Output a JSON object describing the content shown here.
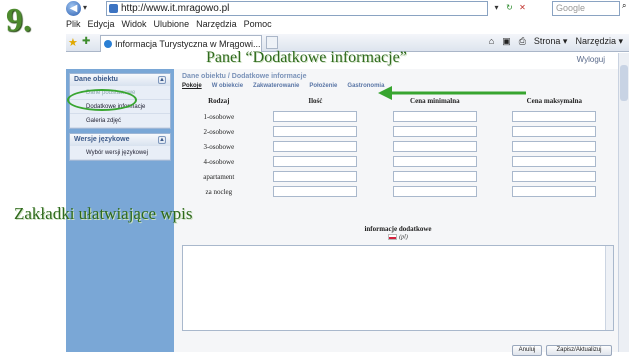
{
  "step_number": "9.",
  "browser": {
    "url": "http://www.it.mragowo.pl",
    "search_placeholder": "Google",
    "menu": [
      "Plik",
      "Edycja",
      "Widok",
      "Ulubione",
      "Narzędzia",
      "Pomoc"
    ],
    "tab_title": "Informacja Turystyczna w Mrągowi...",
    "commands": [
      "Strona ▾",
      "Narzędzia ▾"
    ]
  },
  "page": {
    "logout": "Wyloguj",
    "sidebar": {
      "section1": {
        "title": "Dane obiektu",
        "items": [
          "Dane podstawowe",
          "Dodatkowe informacje",
          "Galeria zdjęć"
        ]
      },
      "section2": {
        "title": "Wersje językowe",
        "items": [
          "Wybór wersji językowej"
        ]
      }
    },
    "breadcrumb": "Dane obiektu / Dodatkowe informacje",
    "tabs": [
      "Pokoje",
      "W obiekcie",
      "Zakwaterowanie",
      "Położenie",
      "Gastronomia"
    ],
    "columns": [
      "Rodzaj",
      "Ilość",
      "Cena minimalna",
      "Cena maksymalna"
    ],
    "rows": [
      "1-osobowe",
      "2-osobowe",
      "3-osobowe",
      "4-osobowe",
      "apartament",
      "za nocleg"
    ],
    "info_label": "informacje dodatkowe",
    "lang_label": "(pl)",
    "buttons": {
      "cancel": "Anuluj",
      "save": "Zapisz/Aktualizuj"
    }
  },
  "annotations": {
    "panel": "Panel “Dodatkowe informacje”",
    "tabs": "Zakładki ułatwiające wpis",
    "highlight_color": "#38a530",
    "text_color": "#2f6a1c"
  }
}
